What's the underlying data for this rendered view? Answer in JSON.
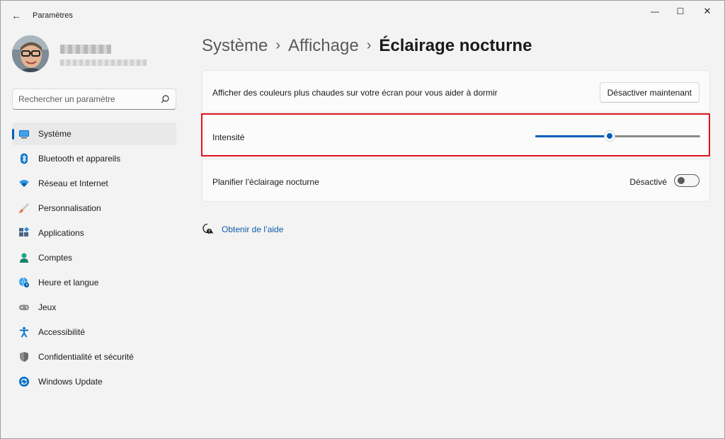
{
  "window": {
    "title": "Paramètres",
    "controls": {
      "minimize": "—",
      "maximize": "☐",
      "close": "✕"
    }
  },
  "search": {
    "placeholder": "Rechercher un paramètre"
  },
  "sidebar": {
    "items": [
      {
        "label": "Système",
        "icon": "system-display-icon",
        "active": true
      },
      {
        "label": "Bluetooth et appareils",
        "icon": "bluetooth-icon"
      },
      {
        "label": "Réseau et Internet",
        "icon": "wifi-icon"
      },
      {
        "label": "Personnalisation",
        "icon": "paintbrush-icon"
      },
      {
        "label": "Applications",
        "icon": "apps-icon"
      },
      {
        "label": "Comptes",
        "icon": "account-icon"
      },
      {
        "label": "Heure et langue",
        "icon": "globe-clock-icon"
      },
      {
        "label": "Jeux",
        "icon": "gamepad-icon"
      },
      {
        "label": "Accessibilité",
        "icon": "accessibility-icon"
      },
      {
        "label": "Confidentialité et sécurité",
        "icon": "shield-icon"
      },
      {
        "label": "Windows Update",
        "icon": "windows-update-icon"
      }
    ]
  },
  "breadcrumb": {
    "level1": "Système",
    "level2": "Affichage",
    "current": "Éclairage nocturne",
    "separator": "›"
  },
  "settings": {
    "warm_colors": {
      "label": "Afficher des couleurs plus chaudes sur votre écran pour vous aider à dormir",
      "button": "Désactiver maintenant"
    },
    "intensity": {
      "label": "Intensité",
      "value": 45
    },
    "schedule": {
      "label": "Planifier l’éclairage nocturne",
      "state_label": "Désactivé",
      "on": false
    }
  },
  "help": {
    "link": "Obtenir de l’aide"
  },
  "colors": {
    "accent": "#005fb8",
    "highlight": "#e0141e",
    "link": "#0f5cab"
  }
}
